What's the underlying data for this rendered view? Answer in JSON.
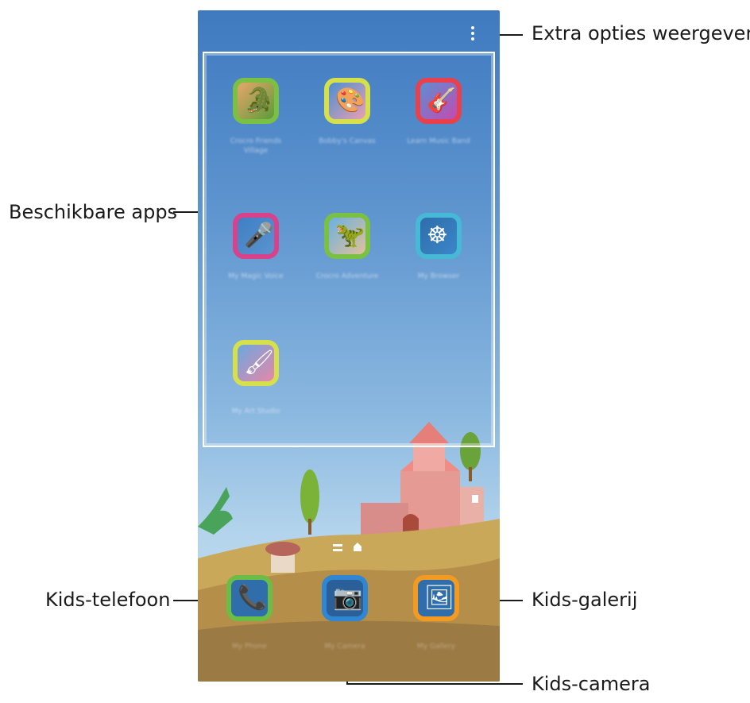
{
  "callouts": {
    "more_options": "Extra opties weergeven.",
    "available_apps": "Beschikbare apps",
    "kids_phone": "Kids-telefoon",
    "kids_gallery": "Kids-galerij",
    "kids_camera": "Kids-camera"
  },
  "apps": [
    {
      "icon": "crocodile-village-icon",
      "label": "Crocro Friends Village",
      "ring": "#7ac143"
    },
    {
      "icon": "bobby-canvas-icon",
      "label": "Bobby's Canvas",
      "ring": "#d6e04a"
    },
    {
      "icon": "music-band-icon",
      "label": "Learn Music Band",
      "ring": "#e8414d"
    },
    {
      "icon": "microphone-icon",
      "label": "My Magic Voice",
      "ring": "#d9418a"
    },
    {
      "icon": "crocro-adventure-icon",
      "label": "Crocro Adventure",
      "ring": "#7ac143"
    },
    {
      "icon": "browser-wheel-icon",
      "label": "My Browser",
      "ring": "#45b9d6"
    },
    {
      "icon": "art-studio-icon",
      "label": "My Art Studio",
      "ring": "#d6e04a"
    }
  ],
  "dock": [
    {
      "icon": "phone-icon",
      "label": "My Phone",
      "ring": "#6abe45"
    },
    {
      "icon": "camera-icon",
      "label": "My Camera",
      "ring": "#2f86d2"
    },
    {
      "icon": "gallery-icon",
      "label": "My Gallery",
      "ring": "#f39a22"
    }
  ],
  "colors": {
    "sky_top": "#3f7ac0",
    "sky_bottom": "#cfe3f2",
    "hill": "#c9a85a"
  }
}
